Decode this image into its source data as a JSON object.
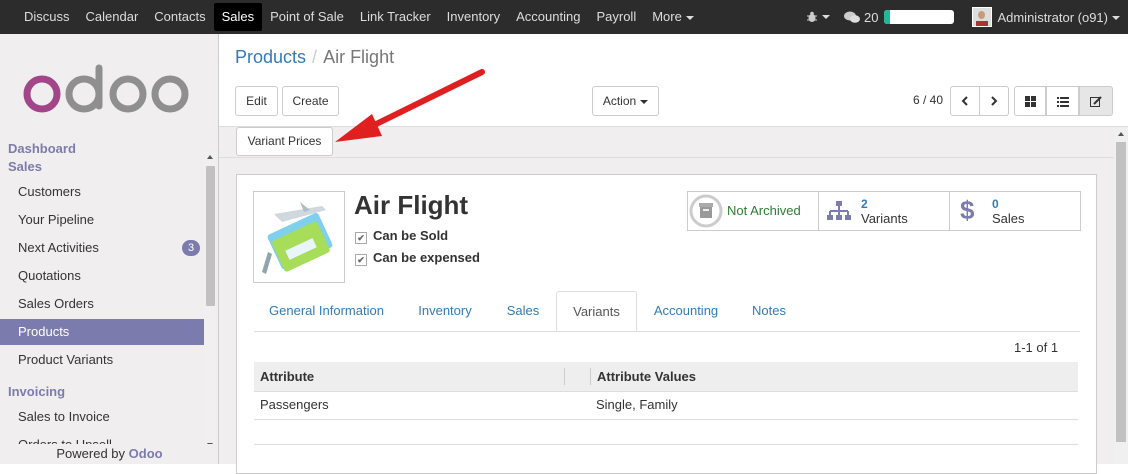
{
  "topbar": {
    "menu": [
      "Discuss",
      "Calendar",
      "Contacts",
      "Sales",
      "Point of Sale",
      "Link Tracker",
      "Inventory",
      "Accounting",
      "Payroll",
      "More"
    ],
    "active_menu": "Sales",
    "messages_count": "20",
    "progress": 0.08,
    "user": "Administrator (o91)"
  },
  "sidebar": {
    "sections": [
      {
        "heading": "Dashboard"
      },
      {
        "heading": "Sales"
      }
    ],
    "items": [
      {
        "label": "Customers"
      },
      {
        "label": "Your Pipeline"
      },
      {
        "label": "Next Activities",
        "badge": "3"
      },
      {
        "label": "Quotations"
      },
      {
        "label": "Sales Orders"
      },
      {
        "label": "Products",
        "active": true
      },
      {
        "label": "Product Variants"
      }
    ],
    "invoicing_heading": "Invoicing",
    "invoicing_items": [
      {
        "label": "Sales to Invoice"
      },
      {
        "label": "Orders to Upsell"
      }
    ],
    "powered_by": "Powered by",
    "powered_brand": "Odoo"
  },
  "breadcrumb": {
    "parent": "Products",
    "separator": "/",
    "current": "Air Flight"
  },
  "toolbar": {
    "edit_label": "Edit",
    "create_label": "Create",
    "action_label": "Action",
    "pager": "6 / 40"
  },
  "statusbar": {
    "variant_prices_label": "Variant Prices"
  },
  "product": {
    "name": "Air Flight",
    "can_be_sold_label": "Can be Sold",
    "can_be_sold": true,
    "can_be_expensed_label": "Can be expensed",
    "can_be_expensed": true
  },
  "smart_buttons": {
    "archive_label": "Not Archived",
    "variants_count": "2",
    "variants_label": "Variants",
    "sales_count": "0",
    "sales_label": "Sales"
  },
  "tabs": [
    "General Information",
    "Inventory",
    "Sales",
    "Variants",
    "Accounting",
    "Notes"
  ],
  "active_tab": "Variants",
  "variants_table": {
    "count": "1-1 of 1",
    "columns": [
      "Attribute",
      "Attribute Values"
    ],
    "rows": [
      {
        "attribute": "Passengers",
        "values": "Single, Family"
      }
    ]
  },
  "colors": {
    "brand": "#7c7bad",
    "link": "#337ab7",
    "archive_green": "#2e7d32",
    "arrow_red": "#e02020"
  }
}
